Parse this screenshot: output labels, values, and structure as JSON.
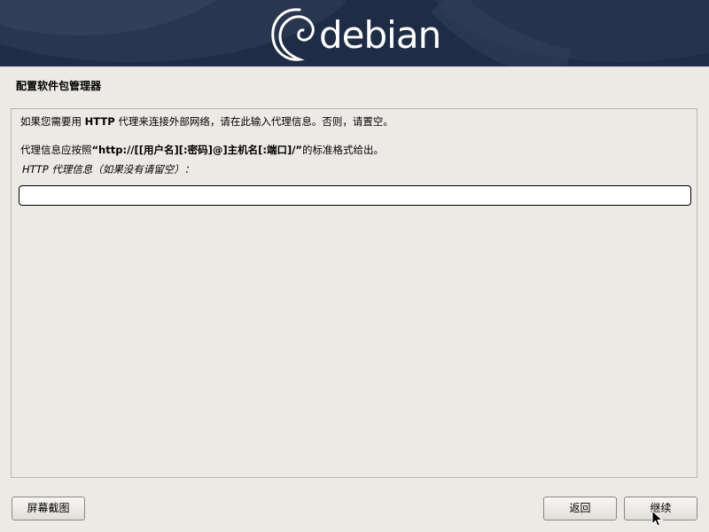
{
  "banner": {
    "logo_text": "debian"
  },
  "page": {
    "title": "配置软件包管理器"
  },
  "content": {
    "line1_prefix": "如果您需要用 ",
    "line1_bold": "HTTP",
    "line1_suffix": " 代理来连接外部网络，请在此输入代理信息。否则，请置空。",
    "line2_prefix": "代理信息应按照",
    "line2_bold": "“http://[[用户名][:密码]@]主机名[:端口]/”",
    "line2_suffix": "的标准格式给出。",
    "field_label": "HTTP 代理信息（如果没有请留空）：",
    "proxy_value": ""
  },
  "buttons": {
    "screenshot": "屏幕截图",
    "back": "返回",
    "continue": "继续"
  },
  "colors": {
    "banner_bg": "#1f2c45",
    "page_bg": "#edeae5"
  }
}
